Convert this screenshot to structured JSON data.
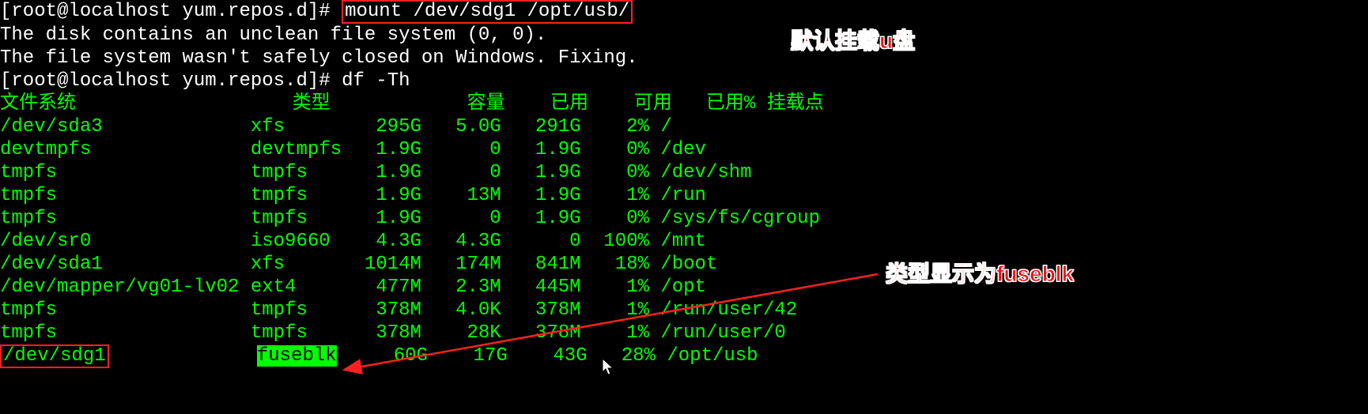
{
  "prompt": {
    "user": "root",
    "host": "localhost",
    "cwd": "yum.repos.d",
    "prefix_open": "[",
    "at": "@",
    "suffix": "]#"
  },
  "lines": {
    "cmd_mount": "mount /dev/sdg1 /opt/usb/",
    "msg1": "The disk contains an unclean file system (0, 0).",
    "msg2": "The file system wasn't safely closed on Windows. Fixing.",
    "cmd_df": "df -Th"
  },
  "header": {
    "fs": "文件系统",
    "type": "类型",
    "size": "容量",
    "used": "已用",
    "avail": "可用",
    "usepct": "已用%",
    "mount": "挂载点"
  },
  "rows": [
    {
      "fs": "/dev/sda3",
      "type": "xfs",
      "size": "295G",
      "used": "5.0G",
      "avail": "291G",
      "usepct": "2%",
      "mount": "/"
    },
    {
      "fs": "devtmpfs",
      "type": "devtmpfs",
      "size": "1.9G",
      "used": "0",
      "avail": "1.9G",
      "usepct": "0%",
      "mount": "/dev"
    },
    {
      "fs": "tmpfs",
      "type": "tmpfs",
      "size": "1.9G",
      "used": "0",
      "avail": "1.9G",
      "usepct": "0%",
      "mount": "/dev/shm"
    },
    {
      "fs": "tmpfs",
      "type": "tmpfs",
      "size": "1.9G",
      "used": "13M",
      "avail": "1.9G",
      "usepct": "1%",
      "mount": "/run"
    },
    {
      "fs": "tmpfs",
      "type": "tmpfs",
      "size": "1.9G",
      "used": "0",
      "avail": "1.9G",
      "usepct": "0%",
      "mount": "/sys/fs/cgroup"
    },
    {
      "fs": "/dev/sr0",
      "type": "iso9660",
      "size": "4.3G",
      "used": "4.3G",
      "avail": "0",
      "usepct": "100%",
      "mount": "/mnt"
    },
    {
      "fs": "/dev/sda1",
      "type": "xfs",
      "size": "1014M",
      "used": "174M",
      "avail": "841M",
      "usepct": "18%",
      "mount": "/boot"
    },
    {
      "fs": "/dev/mapper/vg01-lv02",
      "type": "ext4",
      "size": "477M",
      "used": "2.3M",
      "avail": "445M",
      "usepct": "1%",
      "mount": "/opt"
    },
    {
      "fs": "tmpfs",
      "type": "tmpfs",
      "size": "378M",
      "used": "4.0K",
      "avail": "378M",
      "usepct": "1%",
      "mount": "/run/user/42"
    },
    {
      "fs": "tmpfs",
      "type": "tmpfs",
      "size": "378M",
      "used": "28K",
      "avail": "378M",
      "usepct": "1%",
      "mount": "/run/user/0"
    },
    {
      "fs": "/dev/sdg1",
      "type": "fuseblk",
      "size": "60G",
      "used": "17G",
      "avail": "43G",
      "usepct": "28%",
      "mount": "/opt/usb"
    }
  ],
  "annotations": {
    "top": "默认挂载u盘",
    "right": "类型显示为fuseblk"
  },
  "colwidths": {
    "fs": 22,
    "type": 9,
    "size": 6,
    "used": 6,
    "avail": 6,
    "usepct": 5
  }
}
